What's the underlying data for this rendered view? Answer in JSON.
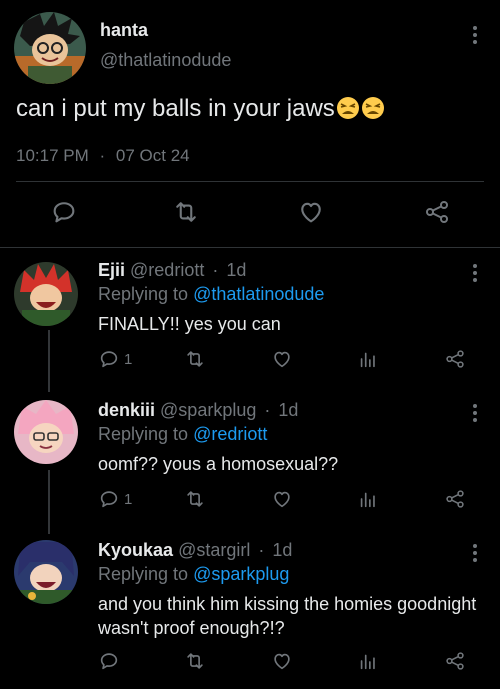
{
  "main": {
    "name": "hanta",
    "handle": "@thatlatinodude",
    "text": "can i put my balls in your jaws",
    "time": "10:17 PM",
    "sep": "·",
    "date": "07 Oct 24"
  },
  "replies": [
    {
      "name": "Ejii",
      "handle": "@redriott",
      "dot": "·",
      "age": "1d",
      "replying_prefix": "Replying to ",
      "replying_to": "@thatlatinodude",
      "text": "FINALLY!! yes you can",
      "reply_count": "1"
    },
    {
      "name": "denkiii",
      "handle": "@sparkplug",
      "dot": "·",
      "age": "1d",
      "replying_prefix": "Replying to ",
      "replying_to": "@redriott",
      "text": "oomf?? yous a homosexual??",
      "reply_count": "1"
    },
    {
      "name": "Kyoukaa",
      "handle": "@stargirl",
      "dot": "·",
      "age": "1d",
      "replying_prefix": "Replying to ",
      "replying_to": "@sparkplug",
      "text": "and you think him kissing the homies goodnight wasn't proof enough?!?",
      "reply_count": ""
    }
  ],
  "colors": {
    "background": "#000000",
    "text": "#e7e9ea",
    "muted": "#71767b",
    "link": "#1d9bf0",
    "divider": "#2f3336"
  }
}
